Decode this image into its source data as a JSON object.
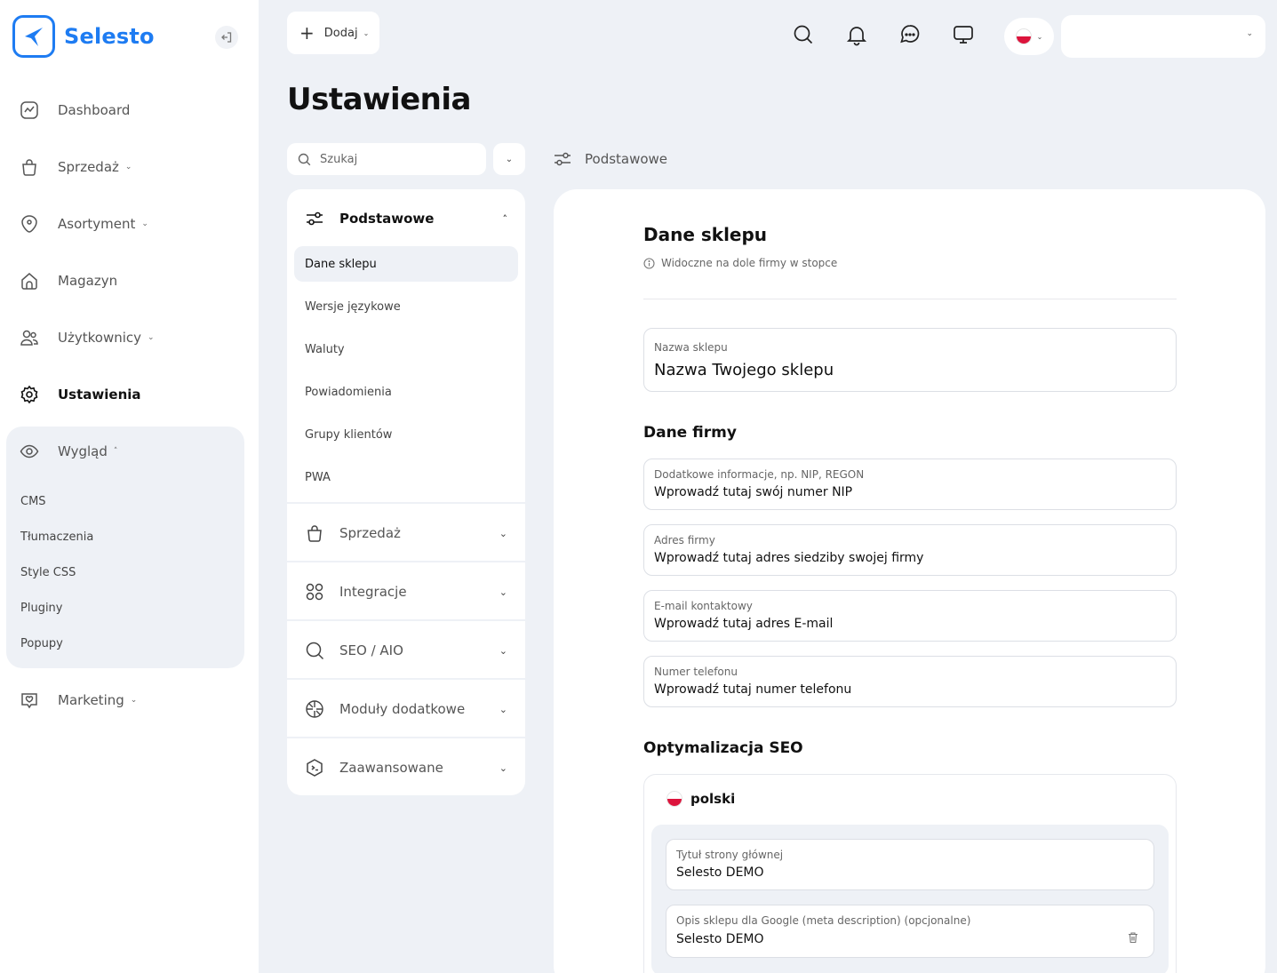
{
  "brand": {
    "name": "Selesto",
    "accent": "#1e7cf2"
  },
  "sidebar": {
    "items": [
      {
        "label": "Dashboard",
        "icon": "chart-icon"
      },
      {
        "label": "Sprzedaż",
        "icon": "bag-icon"
      },
      {
        "label": "Asortyment",
        "icon": "tag-icon"
      },
      {
        "label": "Magazyn",
        "icon": "home-icon"
      },
      {
        "label": "Użytkownicy",
        "icon": "users-icon"
      },
      {
        "label": "Ustawienia",
        "icon": "gear-icon"
      },
      {
        "label": "Wygląd",
        "icon": "eye-icon"
      },
      {
        "label": "Marketing",
        "icon": "heart-chat-icon"
      }
    ],
    "appearance_sub": [
      "CMS",
      "Tłumaczenia",
      "Style CSS",
      "Pluginy",
      "Popupy"
    ]
  },
  "topbar": {
    "add_label": "Dodaj"
  },
  "page": {
    "title": "Ustawienia"
  },
  "settings_nav": {
    "search_placeholder": "Szukaj",
    "sections": [
      {
        "label": "Podstawowe",
        "icon": "sliders-icon",
        "open": true
      },
      {
        "label": "Sprzedaż",
        "icon": "bag-icon"
      },
      {
        "label": "Integracje",
        "icon": "grid-icon"
      },
      {
        "label": "SEO / AIO",
        "icon": "search-icon"
      },
      {
        "label": "Moduły dodatkowe",
        "icon": "aperture-icon"
      },
      {
        "label": "Zaawansowane",
        "icon": "terminal-icon"
      }
    ],
    "basic_items": [
      "Dane sklepu",
      "Wersje językowe",
      "Waluty",
      "Powiadomienia",
      "Grupy klientów",
      "PWA"
    ]
  },
  "breadcrumb": {
    "label": "Podstawowe"
  },
  "content": {
    "title": "Dane sklepu",
    "hint": "Widoczne na dole firmy w stopce",
    "shop_name": {
      "label": "Nazwa sklepu",
      "value": "Nazwa Twojego sklepu"
    },
    "company_heading": "Dane firmy",
    "company_fields": [
      {
        "label": "Dodatkowe informacje, np. NIP, REGON",
        "value": "Wprowadź tutaj swój numer NIP"
      },
      {
        "label": "Adres firmy",
        "value": "Wprowadź tutaj adres siedziby swojej firmy"
      },
      {
        "label": "E-mail kontaktowy",
        "value": "Wprowadź tutaj adres E-mail"
      },
      {
        "label": "Numer telefonu",
        "value": "Wprowadź tutaj numer telefonu"
      }
    ],
    "seo_heading": "Optymalizacja SEO",
    "seo_language": "polski",
    "seo_fields": [
      {
        "label": "Tytuł strony głównej",
        "value": "Selesto DEMO"
      },
      {
        "label": "Opis sklepu dla Google (meta description) (opcjonalne)",
        "value": "Selesto DEMO"
      }
    ]
  }
}
